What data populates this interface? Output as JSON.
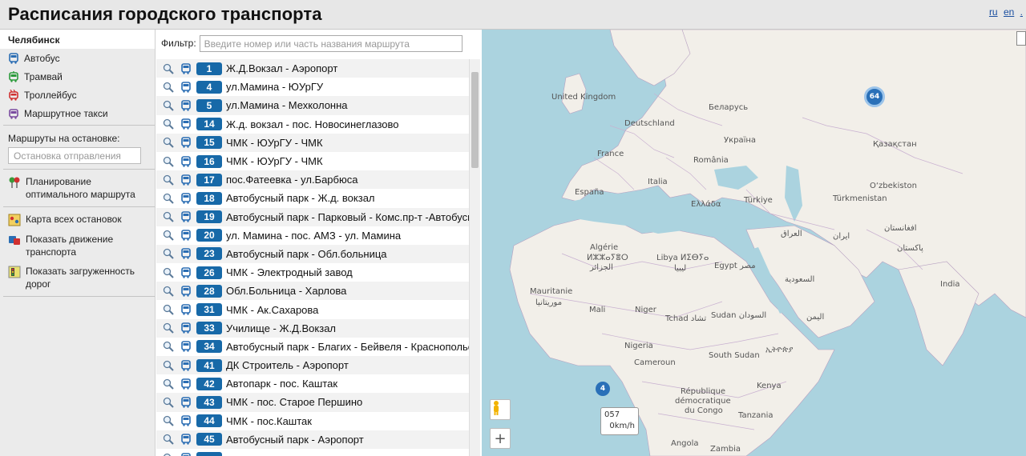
{
  "header": {
    "title": "Расписания городского транспорта",
    "languages": [
      "ru",
      "en",
      "."
    ]
  },
  "sidebar": {
    "city": "Челябинск",
    "transport_types": [
      {
        "label": "Автобус",
        "color": "#2a6db3",
        "icon": "bus-icon"
      },
      {
        "label": "Трамвай",
        "color": "#2a9a3a",
        "icon": "tram-icon"
      },
      {
        "label": "Троллейбус",
        "color": "#d03030",
        "icon": "trolleybus-icon"
      },
      {
        "label": "Маршрутное такси",
        "color": "#7a4aa0",
        "icon": "minibus-icon"
      }
    ],
    "stop_routes_label": "Маршруты на остановке:",
    "stop_placeholder": "Остановка отправления",
    "planning_label": "Планирование оптимального маршрута",
    "tools": [
      {
        "label": "Карта всех остановок",
        "icon": "stops-map-icon"
      },
      {
        "label": "Показать движение транспорта",
        "icon": "traffic-motion-icon"
      },
      {
        "label": "Показать загруженность дорог",
        "icon": "traffic-light-icon"
      }
    ]
  },
  "filter": {
    "label": "Фильтр:",
    "placeholder": "Введите номер или часть названия маршрута"
  },
  "routes": [
    {
      "num": "1",
      "name": "Ж.Д.Вокзал - Аэропорт"
    },
    {
      "num": "4",
      "name": "ул.Мамина - ЮУрГУ"
    },
    {
      "num": "5",
      "name": "ул.Мамина - Мехколонна"
    },
    {
      "num": "14",
      "name": "Ж.д. вокзал - пос. Новосинеглазово"
    },
    {
      "num": "15",
      "name": "ЧМК - ЮУрГУ - ЧМК"
    },
    {
      "num": "16",
      "name": "ЧМК - ЮУрГУ - ЧМК"
    },
    {
      "num": "17",
      "name": "пос.Фатеевка - ул.Барбюса"
    },
    {
      "num": "18",
      "name": "Автобусный парк - Ж.д. вокзал"
    },
    {
      "num": "19",
      "name": "Автобусный парк - Парковый - Комс.пр-т -Автобусн"
    },
    {
      "num": "20",
      "name": "ул. Мамина - пос. АМЗ - ул. Мамина"
    },
    {
      "num": "23",
      "name": "Автобусный парк - Обл.больница"
    },
    {
      "num": "26",
      "name": "ЧМК - Электродный завод"
    },
    {
      "num": "28",
      "name": "Обл.Больница - Харлова"
    },
    {
      "num": "31",
      "name": "ЧМК - Ак.Сахарова"
    },
    {
      "num": "33",
      "name": "Училище - Ж.Д.Вокзал"
    },
    {
      "num": "34",
      "name": "Автобусный парк - Благих - Бейвеля - Краснопольс"
    },
    {
      "num": "41",
      "name": "ДК Строитель - Аэропорт"
    },
    {
      "num": "42",
      "name": "Автопарк - пос. Каштак"
    },
    {
      "num": "43",
      "name": "ЧМК - пос. Старое Першино"
    },
    {
      "num": "44",
      "name": "ЧМК - пос.Каштак"
    },
    {
      "num": "45",
      "name": "Автобусный парк - Аэропорт"
    },
    {
      "num": "",
      "name": ""
    }
  ],
  "map": {
    "labels": [
      {
        "text": "United Kingdom"
      },
      {
        "text": "Беларусь"
      },
      {
        "text": "Deutschland"
      },
      {
        "text": "Україна"
      },
      {
        "text": "Қазақстан"
      },
      {
        "text": "France"
      },
      {
        "text": "România"
      },
      {
        "text": "O‘zbekiston"
      },
      {
        "text": "España"
      },
      {
        "text": "Italia"
      },
      {
        "text": "Türkiye"
      },
      {
        "text": "Türkmenistan"
      },
      {
        "text": "Ελλάδα"
      },
      {
        "text": "Algérie"
      },
      {
        "text": "ⵍⵣⵣⴰⵢⴻⵔ"
      },
      {
        "text": "الجزائر"
      },
      {
        "text": "Libya ⵍⵉⴱⵢⴰ"
      },
      {
        "text": "ليبيا"
      },
      {
        "text": "Egypt مصر"
      },
      {
        "text": "العراق"
      },
      {
        "text": "ایران"
      },
      {
        "text": "افغانستان"
      },
      {
        "text": "پاکستان"
      },
      {
        "text": "India"
      },
      {
        "text": "السعودية"
      },
      {
        "text": "Mauritanie"
      },
      {
        "text": "موريتانيا"
      },
      {
        "text": "Mali"
      },
      {
        "text": "Niger"
      },
      {
        "text": "Tchad تشاد"
      },
      {
        "text": "Sudan السودان"
      },
      {
        "text": "اليمن"
      },
      {
        "text": "Nigeria"
      },
      {
        "text": "South Sudan"
      },
      {
        "text": "ኢትዮጵያ"
      },
      {
        "text": "Cameroun"
      },
      {
        "text": "Kenya"
      },
      {
        "text": "République"
      },
      {
        "text": "démocratique"
      },
      {
        "text": "du Congo"
      },
      {
        "text": "Tanzania"
      },
      {
        "text": "Angola"
      },
      {
        "text": "Zambia"
      }
    ],
    "cluster_markers": [
      "64",
      "4"
    ],
    "speed_tip": {
      "line1": "057",
      "line2": "0km/h"
    },
    "zoom_in": "+",
    "colors": {
      "water": "#abd3df",
      "land": "#f2efe9",
      "border": "#b7a0c0"
    }
  }
}
